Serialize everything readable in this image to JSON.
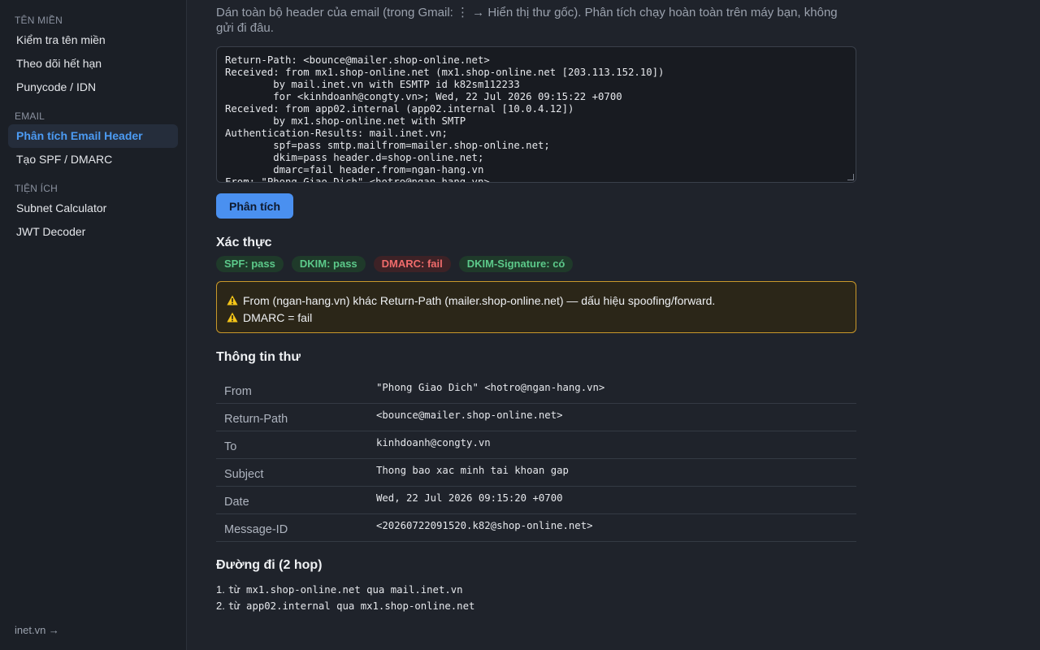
{
  "sidebar": {
    "groups": [
      {
        "title": "TÊN MIỀN",
        "items": [
          {
            "label": "Kiểm tra tên miền"
          },
          {
            "label": "Theo dõi hết hạn"
          },
          {
            "label": "Punycode / IDN"
          }
        ]
      },
      {
        "title": "EMAIL",
        "items": [
          {
            "label": "Phân tích Email Header",
            "active": true
          },
          {
            "label": "Tạo SPF / DMARC"
          }
        ]
      },
      {
        "title": "TIỆN ÍCH",
        "items": [
          {
            "label": "Subnet Calculator"
          },
          {
            "label": "JWT Decoder"
          }
        ]
      }
    ],
    "footer_link": "inet.vn →"
  },
  "main": {
    "description": "Dán toàn bộ header của email (trong Gmail: ⋮ → Hiển thị thư gốc). Phân tích chạy hoàn toàn trên máy bạn, không gửi đi đâu.",
    "header_input": "Return-Path: <bounce@mailer.shop-online.net>\nReceived: from mx1.shop-online.net (mx1.shop-online.net [203.113.152.10])\n        by mail.inet.vn with ESMTP id k82sm112233\n        for <kinhdoanh@congty.vn>; Wed, 22 Jul 2026 09:15:22 +0700\nReceived: from app02.internal (app02.internal [10.0.4.12])\n        by mx1.shop-online.net with SMTP\nAuthentication-Results: mail.inet.vn;\n        spf=pass smtp.mailfrom=mailer.shop-online.net;\n        dkim=pass header.d=shop-online.net;\n        dmarc=fail header.from=ngan-hang.vn\nFrom: \"Phong Giao Dich\" <hotro@ngan-hang.vn>",
    "analyze_button": "Phân tích",
    "auth": {
      "title": "Xác thực",
      "badges": [
        {
          "label": "SPF: pass",
          "status": "pass"
        },
        {
          "label": "DKIM: pass",
          "status": "pass"
        },
        {
          "label": "DMARC: fail",
          "status": "fail"
        },
        {
          "label": "DKIM-Signature: có",
          "status": "pass"
        }
      ]
    },
    "warnings": [
      "From (ngan-hang.vn) khác Return-Path (mailer.shop-online.net) — dấu hiệu spoofing/forward.",
      "DMARC = fail"
    ],
    "info": {
      "title": "Thông tin thư",
      "rows": [
        {
          "key": "From",
          "value": "\"Phong Giao Dich\" <hotro@ngan-hang.vn>"
        },
        {
          "key": "Return-Path",
          "value": "<bounce@mailer.shop-online.net>"
        },
        {
          "key": "To",
          "value": "kinhdoanh@congty.vn"
        },
        {
          "key": "Subject",
          "value": "Thong bao xac minh tai khoan gap"
        },
        {
          "key": "Date",
          "value": "Wed, 22 Jul 2026 09:15:20 +0700"
        },
        {
          "key": "Message-ID",
          "value": "<20260722091520.k82@shop-online.net>"
        }
      ]
    },
    "route": {
      "title": "Đường đi (2 hop)",
      "hops": [
        {
          "num": "1.",
          "text": "từ mx1.shop-online.net qua mail.inet.vn"
        },
        {
          "num": "2.",
          "text": "từ app02.internal qua mx1.shop-online.net"
        }
      ]
    }
  },
  "colors": {
    "background": "#1f232b",
    "sidebar": "#1b1f26",
    "accent": "#4a90f0",
    "pass": "#5cc98a",
    "fail": "#ef6b6b",
    "warning_border": "#c9982a"
  }
}
